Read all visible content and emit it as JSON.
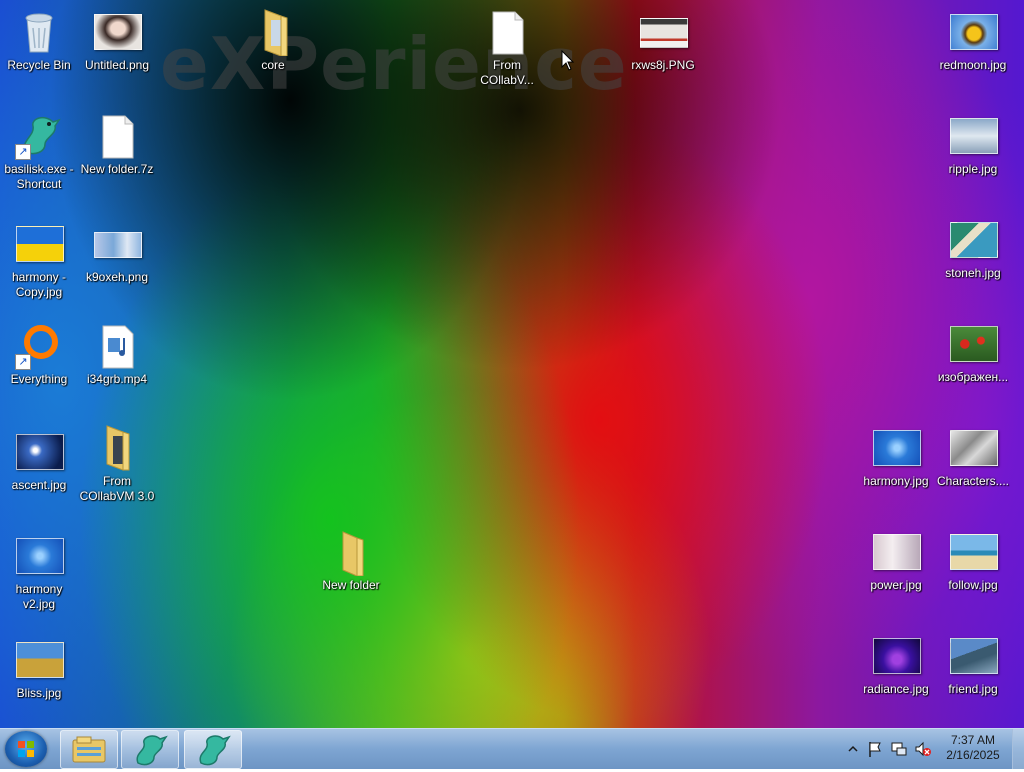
{
  "wallpaper": {
    "text": "eXPerience"
  },
  "icons": {
    "recycle_bin": "Recycle Bin",
    "untitled_png": "Untitled.png",
    "core": "core",
    "from_collab_top": "From COllabV...",
    "rxws8j": "rxws8j.PNG",
    "redmoon": "redmoon.jpg",
    "basilisk": "basilisk.exe - Shortcut",
    "new_folder_7z": "New folder.7z",
    "ripple": "ripple.jpg",
    "harmony_copy": "harmony - Copy.jpg",
    "k9oxeh": "k9oxeh.png",
    "stoneh": "stoneh.jpg",
    "everything": "Everything",
    "i34grb": "i34grb.mp4",
    "izobrazhen": "изображен...",
    "ascent": "ascent.jpg",
    "from_collab_30": "From COllabVM 3.0",
    "harmony": "harmony.jpg",
    "characters": "Characters....",
    "harmony_v2": "harmony v2.jpg",
    "new_folder": "New folder",
    "power": "power.jpg",
    "follow": "follow.jpg",
    "bliss": "Bliss.jpg",
    "radiance": "radiance.jpg",
    "friend": "friend.jpg"
  },
  "taskbar": {
    "clock_time": "7:37 AM",
    "clock_date": "2/16/2025"
  },
  "colors": {
    "folder": "#f2d77e",
    "taskbar": "#7ea5d2",
    "start_orb": "#1c5fb0"
  }
}
